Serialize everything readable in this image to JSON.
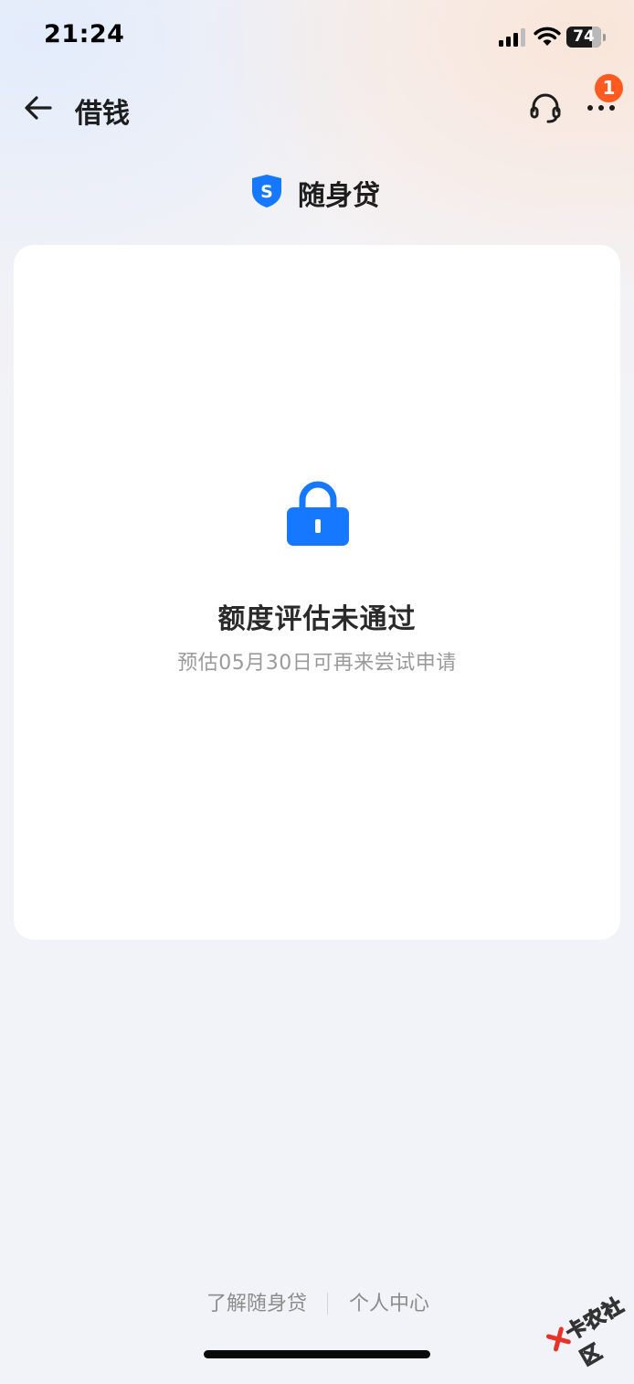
{
  "status_bar": {
    "time": "21:24",
    "battery_level": "74",
    "battery_fraction": 0.74
  },
  "nav": {
    "title": "借钱",
    "back_icon": "back-arrow-icon",
    "support_icon": "headset-icon",
    "more_icon": "more-dots-icon",
    "notification_count": "1"
  },
  "product": {
    "logo_icon": "shield-s-icon",
    "logo_letter": "S",
    "name": "随身贷"
  },
  "result": {
    "icon": "lock-icon",
    "title": "额度评估未通过",
    "subtitle": "预估05月30日可再来尝试申请"
  },
  "footer": {
    "about_link": "了解随身贷",
    "personal_center_link": "个人中心"
  },
  "watermark": {
    "text": "卡农社区"
  },
  "colors": {
    "accent_blue": "#1677ff",
    "badge_orange": "#ff5a1f",
    "page_bg": "#f1f3f8",
    "card_bg": "#ffffff"
  }
}
